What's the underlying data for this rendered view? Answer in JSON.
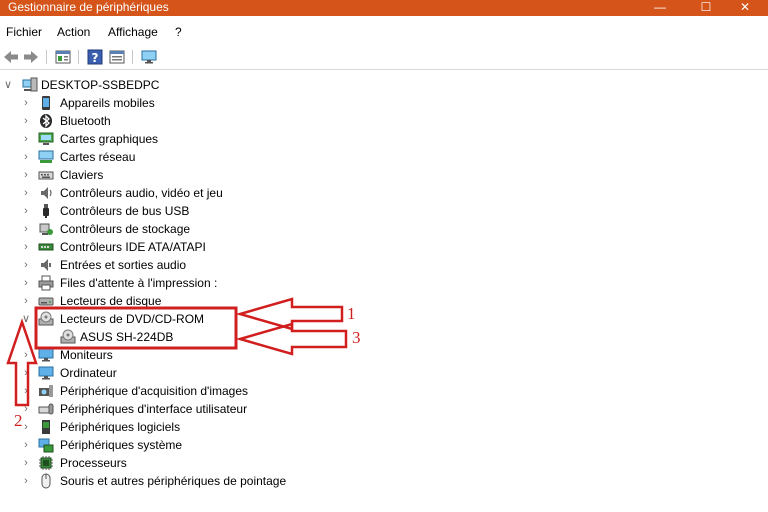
{
  "window": {
    "title": "Gestionnaire de périphériques",
    "controls": [
      "—",
      "☐",
      "✕"
    ]
  },
  "menu": [
    "Fichier",
    "Action",
    "Affichage",
    "?"
  ],
  "toolbar": {
    "icons": [
      "back-arrow-icon",
      "forward-arrow-icon",
      "properties-icon",
      "help-icon",
      "details-icon",
      "monitor-scan-icon"
    ]
  },
  "tree": {
    "root": "DESKTOP-SSBEDPC",
    "categories": [
      {
        "label": "Appareils mobiles",
        "icon": "mobile-device-icon",
        "expanded": false
      },
      {
        "label": "Bluetooth",
        "icon": "bluetooth-icon",
        "expanded": false
      },
      {
        "label": "Cartes graphiques",
        "icon": "display-adapter-icon",
        "expanded": false
      },
      {
        "label": "Cartes réseau",
        "icon": "network-adapter-icon",
        "expanded": false
      },
      {
        "label": "Claviers",
        "icon": "keyboard-icon",
        "expanded": false
      },
      {
        "label": "Contrôleurs audio, vidéo et jeu",
        "icon": "speaker-icon",
        "expanded": false
      },
      {
        "label": "Contrôleurs de bus USB",
        "icon": "usb-icon",
        "expanded": false
      },
      {
        "label": "Contrôleurs de stockage",
        "icon": "storage-controller-icon",
        "expanded": false
      },
      {
        "label": "Contrôleurs IDE ATA/ATAPI",
        "icon": "ide-controller-icon",
        "expanded": false
      },
      {
        "label": "Entrées et sorties audio",
        "icon": "audio-io-icon",
        "expanded": false
      },
      {
        "label": "Files d'attente à l'impression :",
        "icon": "printer-icon",
        "expanded": false
      },
      {
        "label": "Lecteurs de disque",
        "icon": "disk-drive-icon",
        "expanded": false
      },
      {
        "label": "Lecteurs de DVD/CD-ROM",
        "icon": "dvd-drive-icon",
        "expanded": true,
        "children": [
          "ASUS SH-224DB"
        ]
      },
      {
        "label": "Moniteurs",
        "icon": "monitor-icon",
        "expanded": false
      },
      {
        "label": "Ordinateur",
        "icon": "computer-icon",
        "expanded": false
      },
      {
        "label": "Périphérique d'acquisition d'images",
        "icon": "camera-icon",
        "expanded": false
      },
      {
        "label": "Périphériques d'interface utilisateur",
        "icon": "hid-icon",
        "expanded": false
      },
      {
        "label": "Périphériques logiciels",
        "icon": "software-device-icon",
        "expanded": false
      },
      {
        "label": "Périphériques système",
        "icon": "system-device-icon",
        "expanded": false
      },
      {
        "label": "Processeurs",
        "icon": "processor-icon",
        "expanded": false
      },
      {
        "label": "Souris et autres périphériques de pointage",
        "icon": "mouse-icon",
        "expanded": false
      }
    ]
  },
  "annotations": {
    "color": "#d11f1f",
    "labels": [
      "1",
      "2",
      "3"
    ]
  }
}
